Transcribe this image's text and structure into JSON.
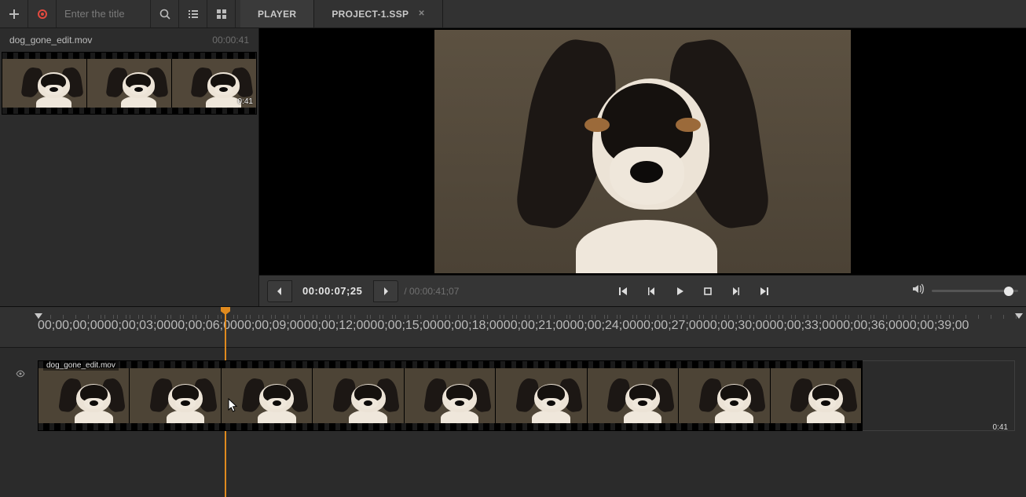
{
  "toolbar": {
    "title_placeholder": "Enter the title",
    "tabs": [
      {
        "label": "PLAYER",
        "active": true
      },
      {
        "label": "PROJECT-1.SSP",
        "active": false,
        "closable": true
      }
    ]
  },
  "bin": {
    "clip_name": "dog_gone_edit.mov",
    "clip_duration": "00:00:41",
    "thumb_badge": "0:41"
  },
  "player": {
    "timecode_current": "00:00:07;25",
    "timecode_total": "/ 00:00:41;07"
  },
  "timeline": {
    "clip_name": "dog_gone_edit.mov",
    "clip_badge": "0:41",
    "ruler_marks": [
      "00;00;00;00",
      "00;00;03;00",
      "00;00;06;00",
      "00;00;09;00",
      "00;00;12;00",
      "00;00;15;00",
      "00;00;18;00",
      "00;00;21;00",
      "00;00;24;00",
      "00;00;27;00",
      "00;00;30;00",
      "00;00;33;00",
      "00;00;36;00",
      "00;00;39;00"
    ]
  }
}
